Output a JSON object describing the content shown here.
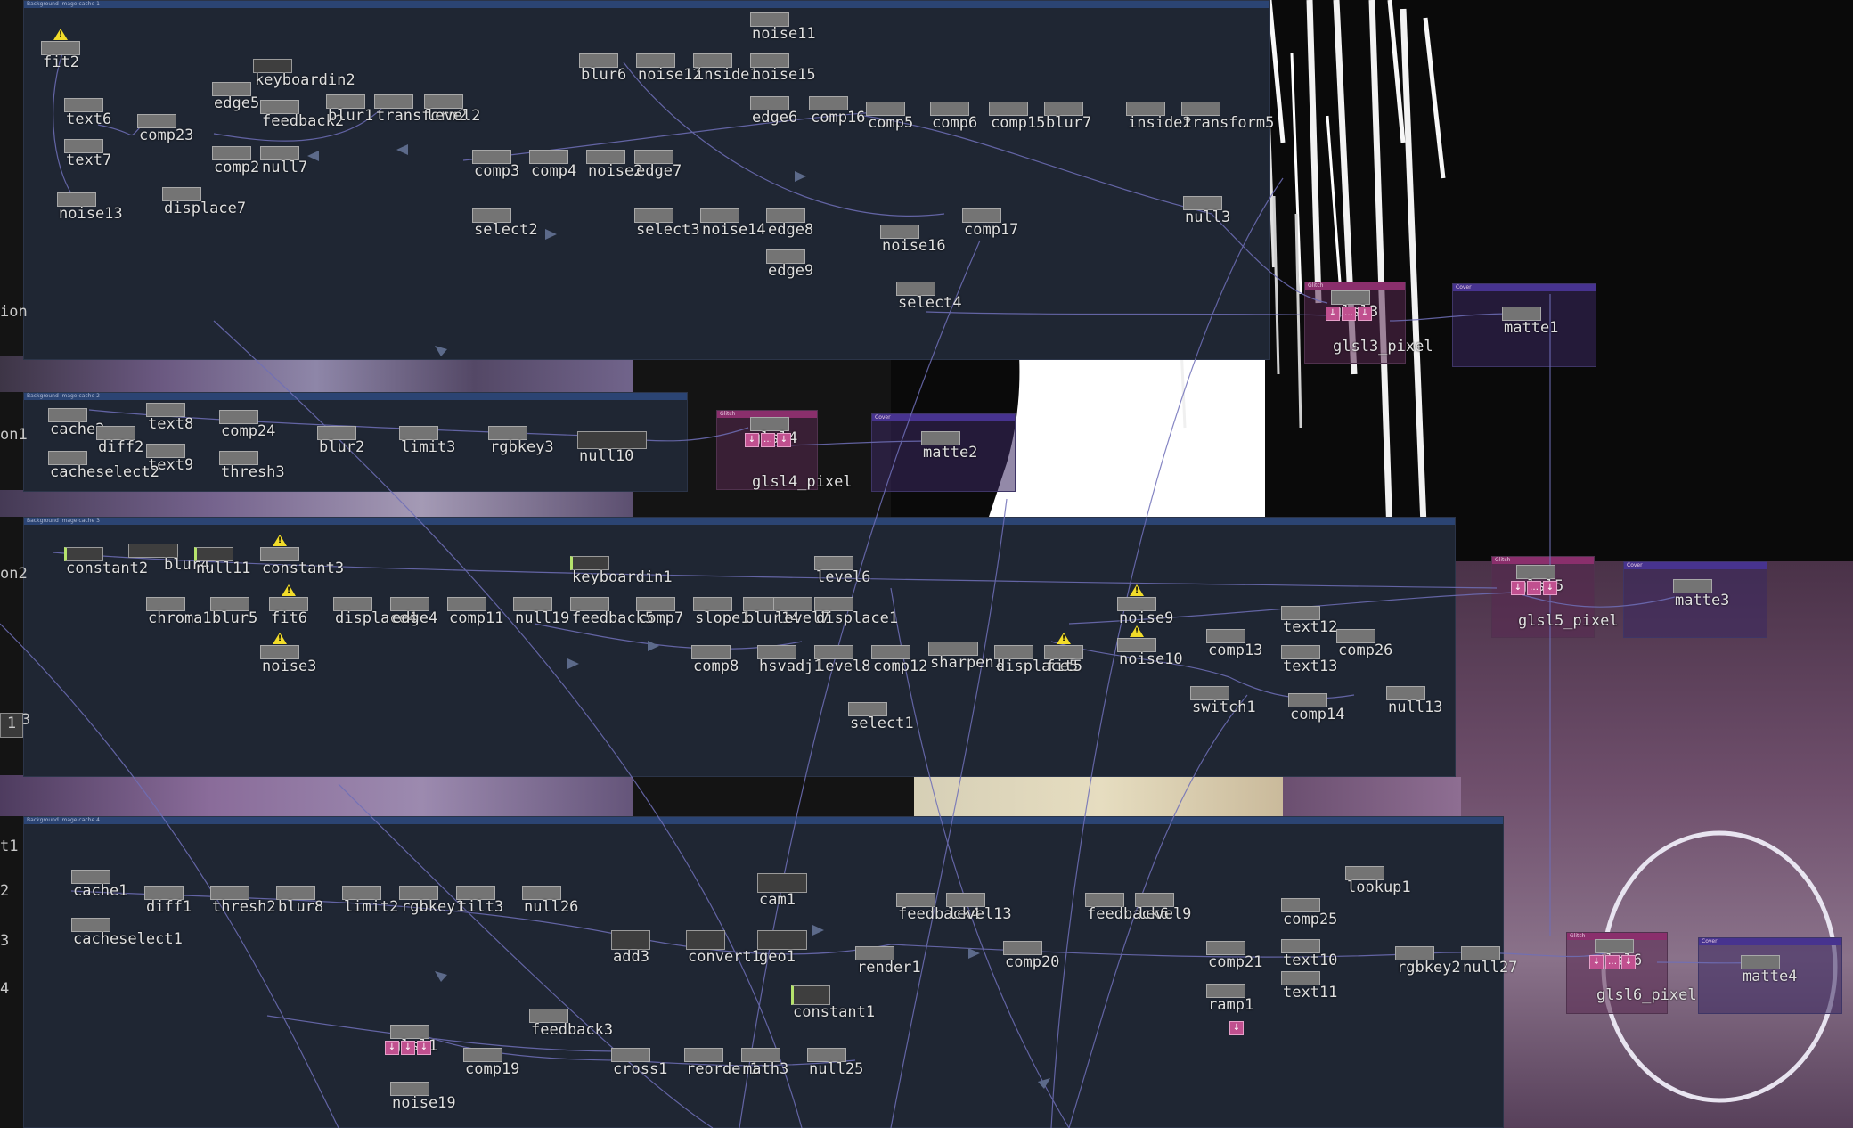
{
  "panels": [
    {
      "title": "Background Image cache 1"
    },
    {
      "title": "Background Image cache 2"
    },
    {
      "title": "Background Image cache 3"
    },
    {
      "title": "Background Image cache 4"
    }
  ],
  "subpanels": {
    "glitch": "Glitch",
    "cover": "Cover"
  },
  "edge_labels": {
    "l1": "ion",
    "l2": "on1",
    "l3": "on2",
    "l4": "3",
    "l5": "1",
    "l6": "t1",
    "l7": "2",
    "l8": "3",
    "l9": "4"
  },
  "side_index": "1",
  "nodes": {
    "fit2": "fit2",
    "keyboardin2": "keyboardin2",
    "edge5": "edge5",
    "feedback2": "feedback2",
    "blur1": "blur1",
    "transform2": "transform2",
    "level2": "level2",
    "text6": "text6",
    "comp23": "comp23",
    "text7": "text7",
    "comp2": "comp2",
    "null7": "null7",
    "noise13": "noise13",
    "displace7": "displace7",
    "noise11": "noise11",
    "blur6": "blur6",
    "noise12": "noise12",
    "inside1": "inside1",
    "noise15": "noise15",
    "edge6": "edge6",
    "comp16": "comp16",
    "comp5": "comp5",
    "comp6": "comp6",
    "comp15": "comp15",
    "blur7": "blur7",
    "inside2": "inside2",
    "transform5": "transform5",
    "comp3": "comp3",
    "comp4": "comp4",
    "noise2": "noise2",
    "edge7": "edge7",
    "select2": "select2",
    "select3": "select3",
    "noise14": "noise14",
    "edge8": "edge8",
    "edge9": "edge9",
    "noise16": "noise16",
    "comp17": "comp17",
    "null3": "null3",
    "select4": "select4",
    "glsl3": "glsl3",
    "glsl3_pixel": "glsl3_pixel",
    "matte1": "matte1",
    "cache2": "cache2",
    "diff2": "diff2",
    "text8": "text8",
    "text9": "text9",
    "cacheselect2": "cacheselect2",
    "comp24": "comp24",
    "thresh3": "thresh3",
    "blur2": "blur2",
    "limit3": "limit3",
    "rgbkey3": "rgbkey3",
    "null10": "null10",
    "glsl4": "glsl4",
    "glsl4_pixel": "glsl4_pixel",
    "matte2": "matte2",
    "constant2": "constant2",
    "blur4": "blur4",
    "null11": "null11",
    "constant3": "constant3",
    "keyboardin1": "keyboardin1",
    "level6": "level6",
    "chroma1": "chroma1",
    "blur5": "blur5",
    "fit6": "fit6",
    "displace4": "displace4",
    "edge4": "edge4",
    "comp11": "comp11",
    "null19": "null19",
    "feedback5": "feedback5",
    "comp7": "comp7",
    "slope1": "slope1",
    "blur14": "blur14",
    "level7": "level7",
    "displace1": "displace1",
    "noise3": "noise3",
    "comp8": "comp8",
    "hsvadj1": "hsvadj1",
    "level8": "level8",
    "comp12": "comp12",
    "sharpen1": "sharpen1",
    "displace5": "displace5",
    "fit5": "fit5",
    "noise9": "noise9",
    "noise10": "noise10",
    "comp13": "comp13",
    "text12": "text12",
    "comp26": "comp26",
    "text13": "text13",
    "switch1": "switch1",
    "comp14": "comp14",
    "null13": "null13",
    "select1": "select1",
    "glsl5": "glsl5",
    "glsl5_pixel": "glsl5_pixel",
    "matte3": "matte3",
    "cache1": "cache1",
    "cacheselect1": "cacheselect1",
    "diff1": "diff1",
    "thresh2": "thresh2",
    "blur8": "blur8",
    "limit2": "limit2",
    "rgbkey1": "rgbkey1",
    "tilt3": "tilt3",
    "null26": "null26",
    "add3": "add3",
    "convert1": "convert1",
    "cam1": "cam1",
    "geo1": "geo1",
    "constant1": "constant1",
    "render1": "render1",
    "feedback4": "feedback4",
    "level13": "level13",
    "comp20": "comp20",
    "feedback6": "feedback6",
    "level9": "level9",
    "comp21": "comp21",
    "ramp1": "ramp1",
    "comp25": "comp25",
    "lookup1": "lookup1",
    "text10": "text10",
    "text11": "text11",
    "rgbkey2": "rgbkey2",
    "null27": "null27",
    "glsl6": "glsl6",
    "glsl6_pixel": "glsl6_pixel",
    "matte4": "matte4",
    "glsl1": "glsl1",
    "noise19": "noise19",
    "comp19": "comp19",
    "feedback3": "feedback3",
    "cross1": "cross1",
    "reorder1": "reorder1",
    "math3": "math3",
    "null25": "null25"
  },
  "colors": {
    "panel": "#1f2633",
    "panel_title": "#2b4473",
    "glitch": "#8a2f6c",
    "cover": "#47338f",
    "wire": "#6f6fb8",
    "warning": "#f2dc2a"
  }
}
